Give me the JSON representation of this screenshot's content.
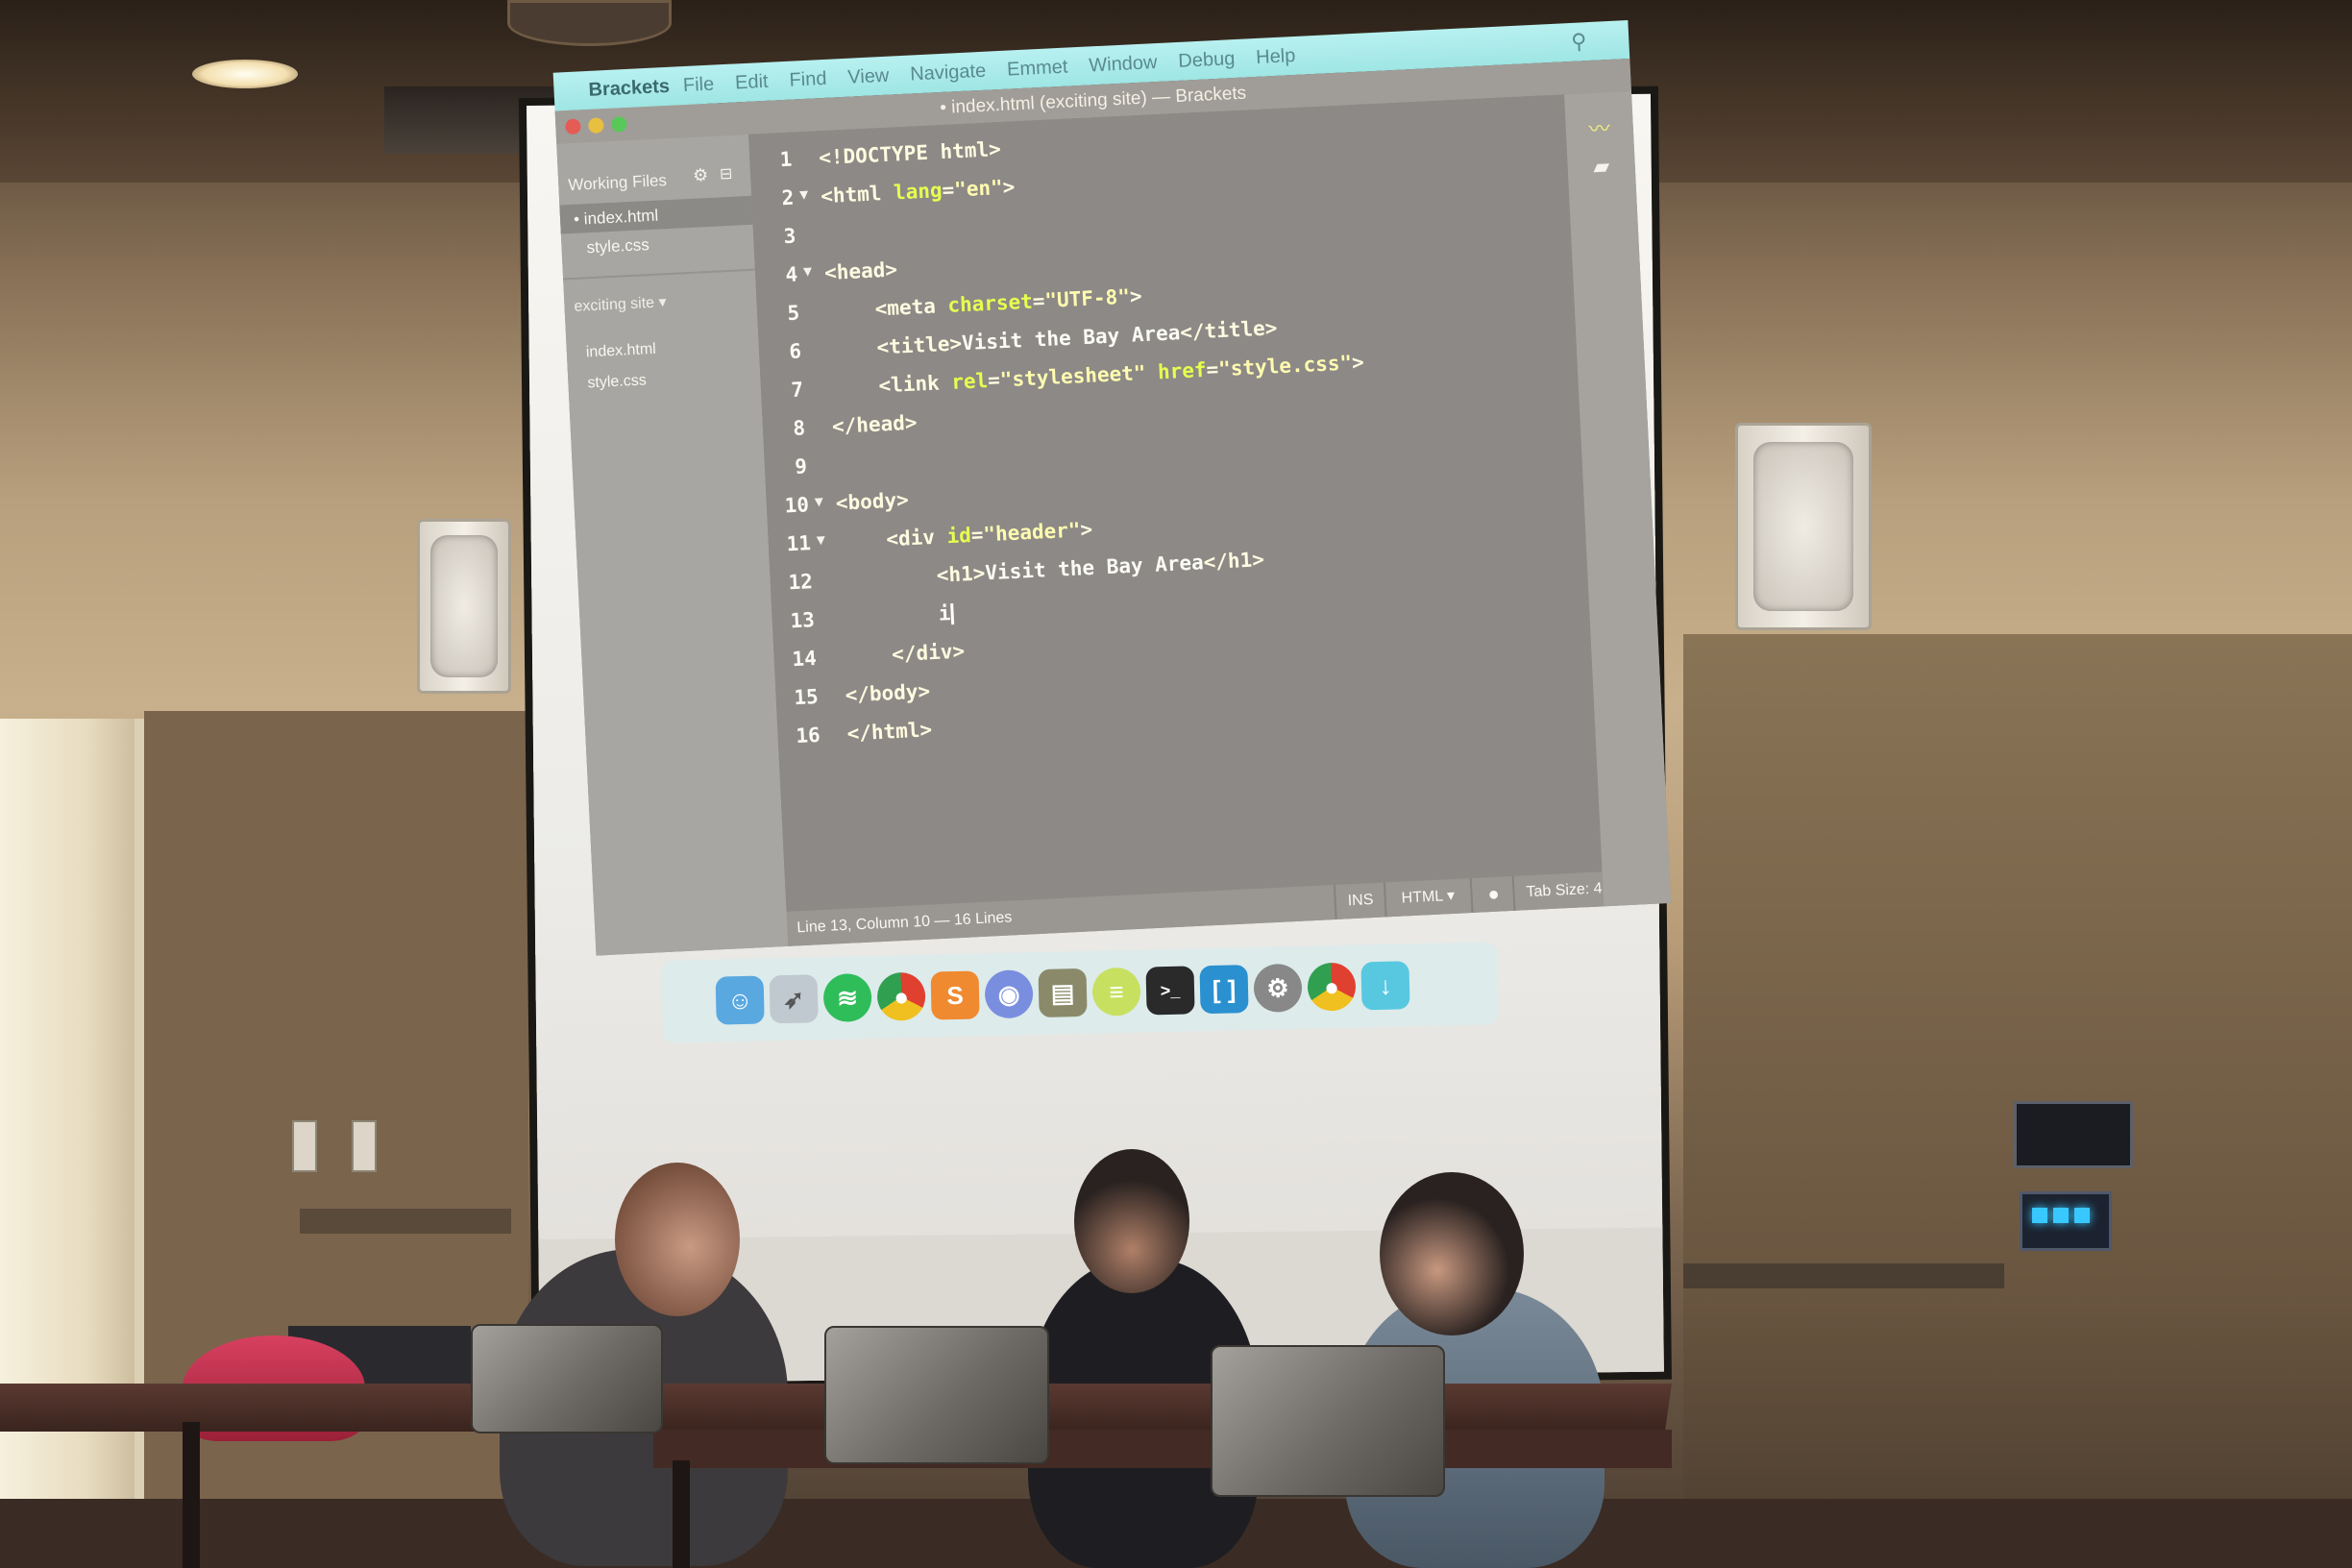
{
  "menubar": {
    "app": "Brackets",
    "items": [
      "File",
      "Edit",
      "Find",
      "View",
      "Navigate",
      "Emmet",
      "Window",
      "Debug",
      "Help"
    ]
  },
  "window": {
    "title": "• index.html (exciting site) — Brackets"
  },
  "sidebar": {
    "working_files_label": "Working Files",
    "working_files": [
      "• index.html",
      "style.css"
    ],
    "project_label": "exciting site ▾",
    "project_files": [
      "index.html",
      "style.css"
    ]
  },
  "editor": {
    "lines": [
      {
        "n": "1",
        "fold": "",
        "indent": "",
        "parts": [
          [
            "tag",
            "<!DOCTYPE html>"
          ]
        ]
      },
      {
        "n": "2",
        "fold": "▼",
        "indent": "",
        "parts": [
          [
            "tag",
            "<html "
          ],
          [
            "attr",
            "lang"
          ],
          [
            "tag",
            "="
          ],
          [
            "str",
            "\"en\""
          ],
          [
            "tag",
            ">"
          ]
        ]
      },
      {
        "n": "3",
        "fold": "",
        "indent": "",
        "parts": []
      },
      {
        "n": "4",
        "fold": "▼",
        "indent": "",
        "parts": [
          [
            "tag",
            "<head>"
          ]
        ]
      },
      {
        "n": "5",
        "fold": "",
        "indent": "    ",
        "parts": [
          [
            "tag",
            "<meta "
          ],
          [
            "attr",
            "charset"
          ],
          [
            "tag",
            "="
          ],
          [
            "str",
            "\"UTF-8\""
          ],
          [
            "tag",
            ">"
          ]
        ]
      },
      {
        "n": "6",
        "fold": "",
        "indent": "    ",
        "parts": [
          [
            "tag",
            "<title>"
          ],
          [
            "txt",
            "Visit the Bay Area"
          ],
          [
            "tag",
            "</title>"
          ]
        ]
      },
      {
        "n": "7",
        "fold": "",
        "indent": "    ",
        "parts": [
          [
            "tag",
            "<link "
          ],
          [
            "attr",
            "rel"
          ],
          [
            "tag",
            "="
          ],
          [
            "str",
            "\"stylesheet\""
          ],
          [
            "attr",
            " href"
          ],
          [
            "tag",
            "="
          ],
          [
            "str",
            "\"style.css\""
          ],
          [
            "tag",
            ">"
          ]
        ]
      },
      {
        "n": "8",
        "fold": "",
        "indent": "",
        "parts": [
          [
            "tag",
            "</head>"
          ]
        ]
      },
      {
        "n": "9",
        "fold": "",
        "indent": "",
        "parts": []
      },
      {
        "n": "10",
        "fold": "▼",
        "indent": "",
        "parts": [
          [
            "tag",
            "<body>"
          ]
        ]
      },
      {
        "n": "11",
        "fold": "▼",
        "indent": "    ",
        "parts": [
          [
            "tag",
            "<div "
          ],
          [
            "attr",
            "id"
          ],
          [
            "tag",
            "="
          ],
          [
            "str",
            "\"header\""
          ],
          [
            "tag",
            ">"
          ]
        ]
      },
      {
        "n": "12",
        "fold": "",
        "indent": "        ",
        "parts": [
          [
            "tag",
            "<h1>"
          ],
          [
            "txt",
            "Visit the Bay Area"
          ],
          [
            "tag",
            "</h1>"
          ]
        ]
      },
      {
        "n": "13",
        "fold": "",
        "indent": "        ",
        "parts": [
          [
            "txt",
            "i"
          ]
        ],
        "cursor": true
      },
      {
        "n": "14",
        "fold": "",
        "indent": "    ",
        "parts": [
          [
            "tag",
            "</div>"
          ]
        ]
      },
      {
        "n": "15",
        "fold": "",
        "indent": "",
        "parts": [
          [
            "tag",
            "</body>"
          ]
        ]
      },
      {
        "n": "16",
        "fold": "",
        "indent": "",
        "parts": [
          [
            "tag",
            "</html>"
          ]
        ]
      }
    ]
  },
  "statusbar": {
    "position": "Line 13, Column 10 — 16 Lines",
    "mode": "INS",
    "language": "HTML ▾",
    "tab_size": "Tab Size: 4"
  },
  "dock": {
    "apps": [
      "finder",
      "launchpad",
      "spotify",
      "chrome",
      "sublime",
      "discord",
      "scripts",
      "database",
      "terminal",
      "brackets",
      "system-preferences",
      "chrome",
      "downloads"
    ]
  },
  "colors": {
    "menubar": "#9ee6e4",
    "editor_bg": "#8c8986",
    "tag": "#fffbe0",
    "attr": "#e6ff50",
    "string": "#fffbb0"
  }
}
